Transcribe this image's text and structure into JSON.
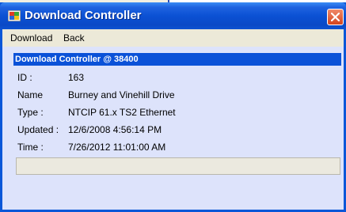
{
  "window": {
    "title": "Download Controller",
    "icons": {
      "app": "app-window-icon",
      "close": "close-icon"
    }
  },
  "menu": {
    "items": [
      "Download",
      "Back"
    ]
  },
  "panel": {
    "header": "Download Controller @ 38400",
    "fields": [
      {
        "label": "ID :",
        "value": "163"
      },
      {
        "label": "Name",
        "value": "Burney and Vinehill Drive"
      },
      {
        "label": "Type :",
        "value": "NTCIP 61.x TS2 Ethernet"
      },
      {
        "label": "Updated :",
        "value": "12/6/2008 4:56:14 PM"
      },
      {
        "label": "Time :",
        "value": "7/26/2012 11:01:00 AM"
      }
    ],
    "status_text": ""
  },
  "colors": {
    "titlebar": "#0b51d4",
    "panel_header": "#0b52d8",
    "panel_bg": "#dde3fb",
    "close": "#d4441e"
  }
}
